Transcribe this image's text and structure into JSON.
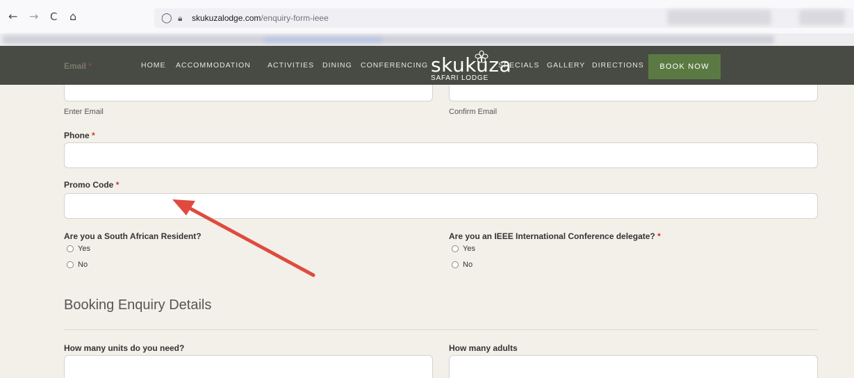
{
  "browser": {
    "back_glyph": "←",
    "forward_glyph": "→",
    "reload_glyph": "C",
    "home_glyph": "⌂",
    "shield_glyph": "◯",
    "lock_glyph": "🔒︎",
    "url_domain": "skukuzalodge.com",
    "url_path": "/enquiry-form-ieee"
  },
  "header": {
    "nav_left": [
      "HOME",
      "ACCOMMODATION",
      "ACTIVITIES",
      "DINING",
      "CONFERENCING"
    ],
    "logo_word": "skukuza",
    "logo_sub": "SAFARI LODGE",
    "nav_right": [
      "SPECIALS",
      "GALLERY",
      "DIRECTIONS"
    ],
    "book_label": "BOOK NOW",
    "hidden_label": "Email",
    "hidden_req": "*"
  },
  "form": {
    "email_sublabel": "Enter Email",
    "confirm_sublabel": "Confirm Email",
    "phone_label": "Phone",
    "promo_label": "Promo Code",
    "required_mark": "*",
    "resident_question": "Are you a South African Resident?",
    "delegate_question": "Are you an IEEE International Conference delegate?",
    "yes": "Yes",
    "no": "No",
    "section_title": "Booking Enquiry Details",
    "units_label": "How many units do you need?",
    "adults_label": "How many adults"
  },
  "colors": {
    "header_bg": "#484b43",
    "book_button": "#5b7a43",
    "page_bg": "#f2f0e8",
    "annotation_arrow": "#e04a3f"
  }
}
